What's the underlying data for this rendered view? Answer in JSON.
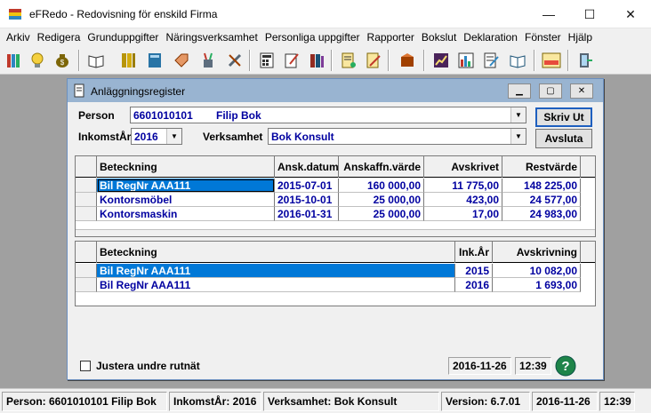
{
  "window": {
    "title": "eFRedo - Redovisning för enskild Firma"
  },
  "menu": [
    "Arkiv",
    "Redigera",
    "Grunduppgifter",
    "Näringsverksamhet",
    "Personliga uppgifter",
    "Rapporter",
    "Bokslut",
    "Deklaration",
    "Fönster",
    "Hjälp"
  ],
  "child": {
    "title": "Anläggningsregister",
    "person_label": "Person",
    "person_id": "6601010101",
    "person_name": "Filip Bok",
    "year_label": "InkomstÅr",
    "year_value": "2016",
    "verksamhet_label": "Verksamhet",
    "verksamhet_value": "Bok Konsult",
    "print_button": "Skriv Ut",
    "close_button": "Avsluta"
  },
  "assets_table": {
    "headers": [
      "Beteckning",
      "Ansk.datum",
      "Anskaffn.värde",
      "Avskrivet",
      "Restvärde"
    ],
    "rows": [
      [
        "Bil RegNr AAA111",
        "2015-07-01",
        "160 000,00",
        "11 775,00",
        "148 225,00"
      ],
      [
        "Kontorsmöbel",
        "2015-10-01",
        "25 000,00",
        "423,00",
        "24 577,00"
      ],
      [
        "Kontorsmaskin",
        "2016-01-31",
        "25 000,00",
        "17,00",
        "24 983,00"
      ]
    ]
  },
  "depreciation_table": {
    "headers": [
      "Beteckning",
      "Ink.År",
      "Avskrivning"
    ],
    "rows": [
      [
        "Bil RegNr AAA111",
        "2015",
        "10 082,00"
      ],
      [
        "Bil RegNr AAA111",
        "2016",
        "1 693,00"
      ]
    ]
  },
  "child_status": {
    "checkbox_label": "Justera undre rutnät",
    "date": "2016-11-26",
    "time": "12:39"
  },
  "statusbar": {
    "person": "Person: 6601010101  Filip Bok",
    "year": "InkomstÅr: 2016",
    "verksamhet": "Verksamhet: Bok Konsult",
    "version": "Version: 6.7.01",
    "date": "2016-11-26",
    "time": "12:39"
  },
  "colors": {
    "accent": "#0078d7",
    "value_text": "#0000a0",
    "child_title": "#99b4d1"
  },
  "icons": [
    "app-icon",
    "minimize-icon",
    "maximize-icon",
    "close-icon",
    "help-icon"
  ]
}
